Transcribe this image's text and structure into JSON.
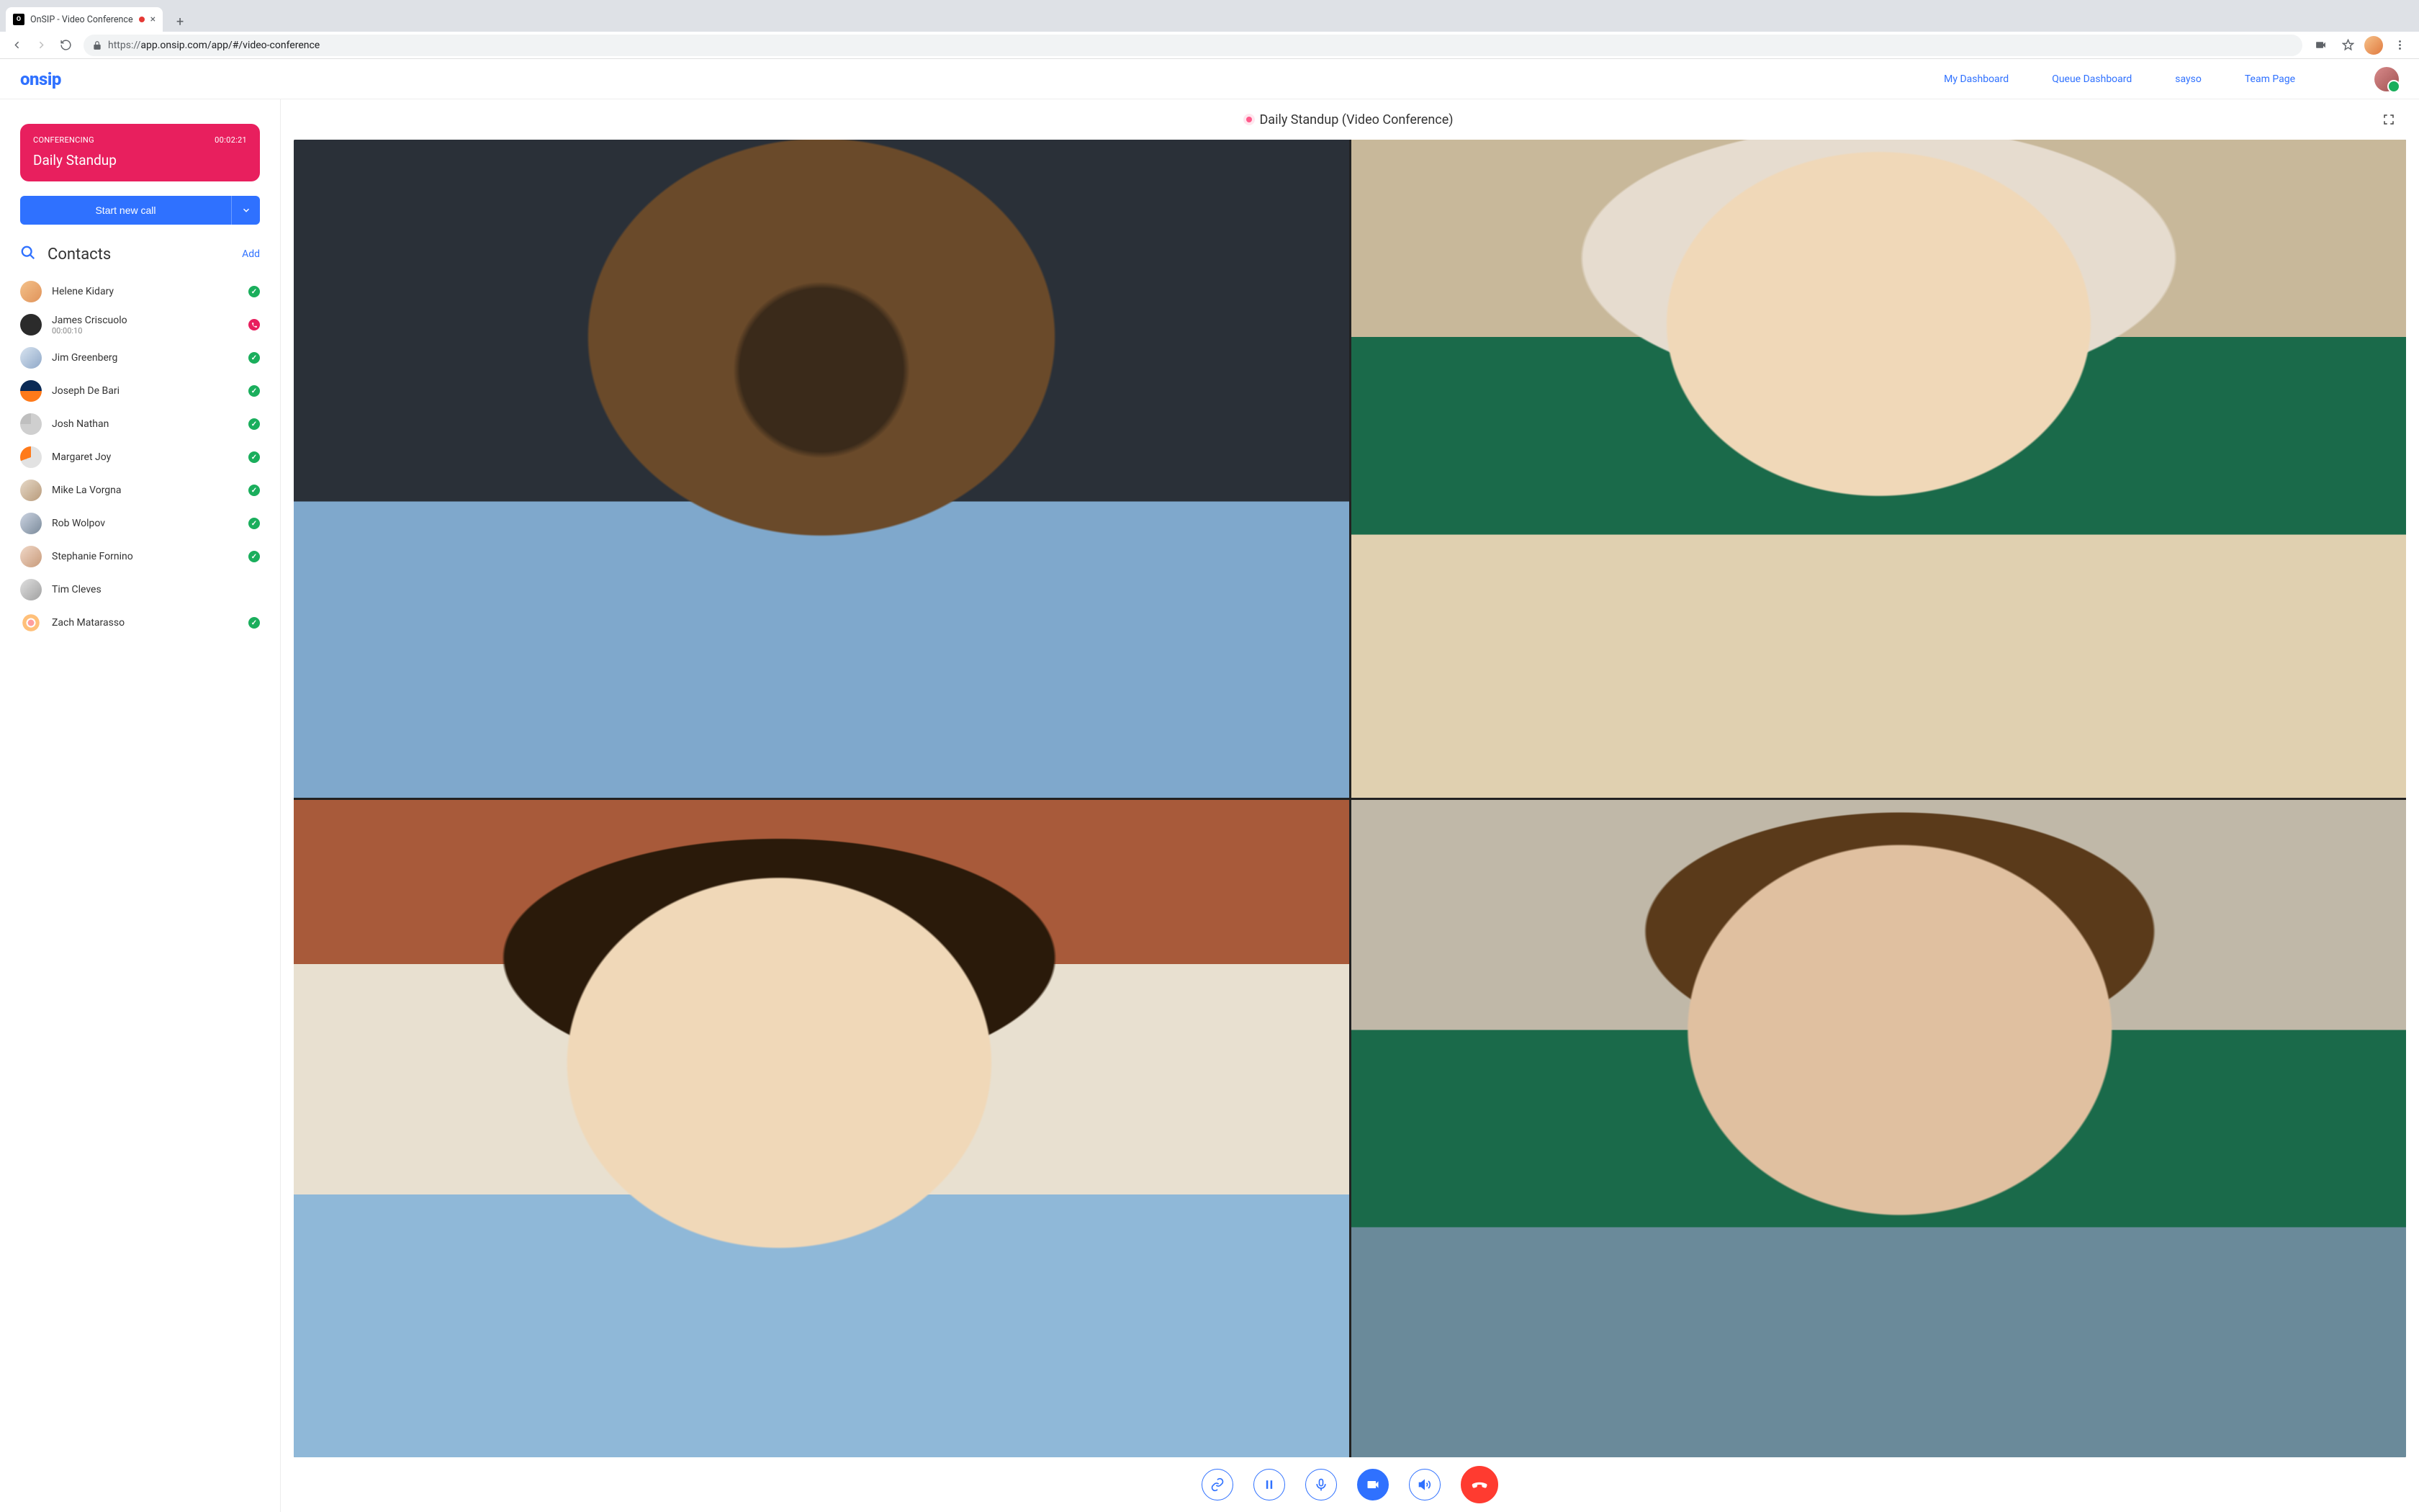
{
  "browser": {
    "tab_title": "OnSIP - Video Conference",
    "url_scheme": "https://",
    "url_rest": "app.onsip.com/app/#/video-conference"
  },
  "header": {
    "logo_text": "onsip",
    "nav": {
      "dashboard": "My Dashboard",
      "queue": "Queue Dashboard",
      "sayso": "sayso",
      "team": "Team Page"
    }
  },
  "sidebar": {
    "conference_card": {
      "label": "CONFERENCING",
      "duration": "00:02:21",
      "title": "Daily Standup"
    },
    "start_call_label": "Start new call",
    "contacts_heading": "Contacts",
    "add_label": "Add",
    "contacts": [
      {
        "name": "Helene Kidary",
        "sub": "",
        "status": "available",
        "ava": "c0"
      },
      {
        "name": "James Criscuolo",
        "sub": "00:00:10",
        "status": "on-call",
        "ava": "c1"
      },
      {
        "name": "Jim Greenberg",
        "sub": "",
        "status": "available",
        "ava": "c2"
      },
      {
        "name": "Joseph De Bari",
        "sub": "",
        "status": "available",
        "ava": "c3"
      },
      {
        "name": "Josh Nathan",
        "sub": "",
        "status": "available",
        "ava": "c4"
      },
      {
        "name": "Margaret Joy",
        "sub": "",
        "status": "available",
        "ava": "c5"
      },
      {
        "name": "Mike La Vorgna",
        "sub": "",
        "status": "available",
        "ava": "c6"
      },
      {
        "name": "Rob Wolpov",
        "sub": "",
        "status": "available",
        "ava": "c7"
      },
      {
        "name": "Stephanie Fornino",
        "sub": "",
        "status": "available",
        "ava": "c8"
      },
      {
        "name": "Tim Cleves",
        "sub": "",
        "status": "",
        "ava": "c9"
      },
      {
        "name": "Zach Matarasso",
        "sub": "",
        "status": "available",
        "ava": "c10"
      }
    ]
  },
  "conference": {
    "title": "Daily Standup (Video Conference)"
  }
}
